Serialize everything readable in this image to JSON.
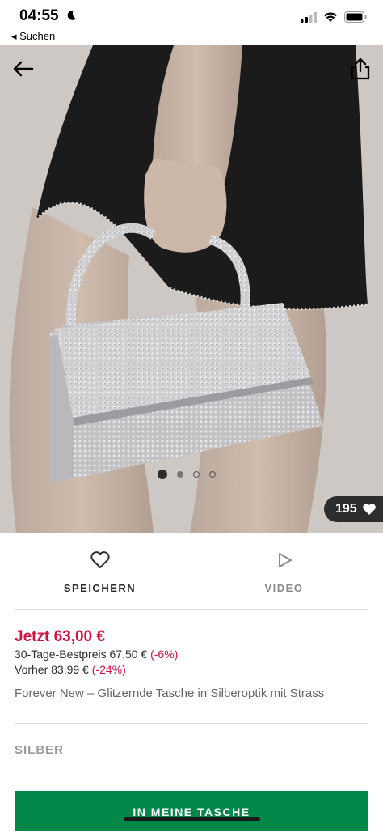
{
  "status_bar": {
    "time": "04:55",
    "back_app": "◂ Suchen"
  },
  "product": {
    "likes": "195",
    "gallery": {
      "slide_count": 4,
      "active_index": 0
    },
    "actions": {
      "save_label": "SPEICHERN",
      "video_label": "VIDEO"
    },
    "price_now": "Jetzt 63,00 €",
    "best_price_label": "30-Tage-Bestpreis 67,50 € ",
    "best_price_discount": "(-6%)",
    "previous_price_label": "Vorher 83,99 € ",
    "previous_price_discount": "(-24%)",
    "title": "Forever New – Glitzernde Tasche in Silberoptik mit Strass",
    "color": "SILBER",
    "add_to_cart_label": "IN MEINE TASCHE"
  },
  "colors": {
    "sale": "#d01345",
    "cart_button": "#018849",
    "text": "#2d2d2d",
    "muted": "#8a8a8a"
  },
  "icons": [
    "moon-icon",
    "signal-icon",
    "wifi-icon",
    "battery-icon",
    "back-arrow-icon",
    "share-icon",
    "heart-icon",
    "play-icon"
  ]
}
